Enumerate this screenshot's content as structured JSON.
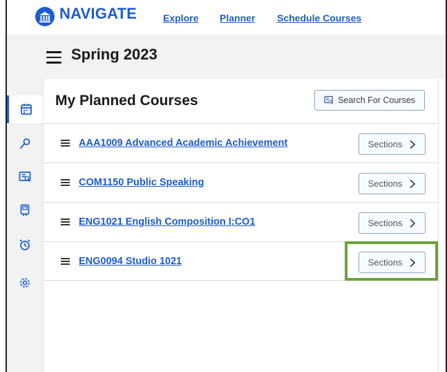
{
  "brand": {
    "name": "NAVIGATE"
  },
  "nav": {
    "links": [
      {
        "label": "Explore"
      },
      {
        "label": "Planner"
      },
      {
        "label": "Schedule Courses"
      }
    ]
  },
  "term": {
    "title": "Spring 2023"
  },
  "rail": {
    "items": [
      {
        "icon": "calendar-icon",
        "active": true
      },
      {
        "icon": "search-key-icon",
        "active": false
      },
      {
        "icon": "course-catalog-icon",
        "active": false
      },
      {
        "icon": "notebook-icon",
        "active": false
      },
      {
        "icon": "alarm-clock-icon",
        "active": false
      },
      {
        "icon": "settings-gear-icon",
        "active": false
      }
    ]
  },
  "panel": {
    "title": "My Planned Courses",
    "search_button": "Search For Courses",
    "courses": [
      {
        "name": "AAA1009 Advanced Academic Achievement",
        "action": "Sections"
      },
      {
        "name": "COM1150 Public Speaking",
        "action": "Sections"
      },
      {
        "name": "ENG1021 English Composition I:CO1",
        "action": "Sections"
      },
      {
        "name": "ENG0094 Studio 1021",
        "action": "Sections"
      }
    ]
  },
  "colors": {
    "accent": "#1c5bd1",
    "highlight": "#6aa33a",
    "rail_bg": "#f2f2f2"
  }
}
